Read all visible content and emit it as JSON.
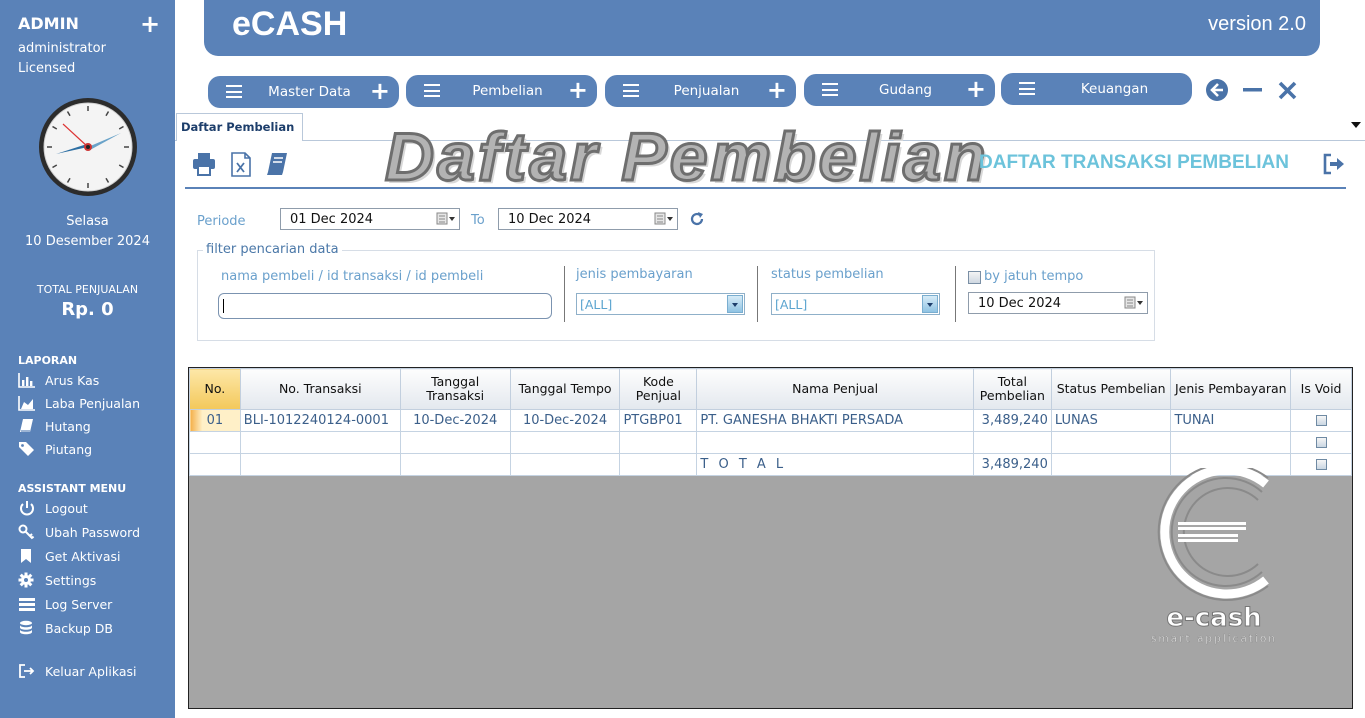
{
  "sidebar": {
    "user": "ADMIN",
    "role_line1": "administrator",
    "role_line2": "Licensed",
    "day": "Selasa",
    "date": "10 Desember 2024",
    "total_label": "TOTAL PENJUALAN",
    "total_value": "Rp. 0",
    "laporan_heading": "LAPORAN",
    "laporan": [
      "Arus Kas",
      "Laba Penjualan",
      "Hutang",
      "Piutang"
    ],
    "assistant_heading": "ASSISTANT MENU",
    "assistant": [
      "Logout",
      "Ubah Password",
      "Get Aktivasi",
      "Settings",
      "Log Server",
      "Backup DB"
    ],
    "exit_label": "Keluar Aplikasi"
  },
  "header": {
    "app_name": "eCASH",
    "version": "version 2.0"
  },
  "menu": [
    "Master Data",
    "Pembelian",
    "Penjualan",
    "Gudang",
    "Keuangan"
  ],
  "tab": {
    "label": "Daftar Pembelian"
  },
  "page": {
    "banner_title": "Daftar Pembelian",
    "heading": "DAFTAR TRANSAKSI PEMBELIAN"
  },
  "filters": {
    "periode_label": "Periode",
    "from_date": "01 Dec 2024",
    "to_label": "To",
    "to_date": "10 Dec 2024",
    "fieldset_legend": "filter pencarian data",
    "search_label": "nama pembeli / id transaksi / id pembeli",
    "search_value": "",
    "jenis_label": "jenis pembayaran",
    "jenis_value": "[ALL]",
    "status_label": "status pembelian",
    "status_value": "[ALL]",
    "jatuh_tempo_label": "by jatuh tempo",
    "jatuh_tempo_date": "10 Dec 2024"
  },
  "grid": {
    "headers": [
      "No.",
      "No. Transaksi",
      "Tanggal Transaksi",
      "Tanggal Tempo",
      "Kode Penjual",
      "Nama Penjual",
      "Total Pembelian",
      "Status Pembelian",
      "Jenis Pembayaran",
      "Is Void"
    ],
    "rows": [
      [
        "01",
        "BLI-1012240124-0001",
        "10-Dec-2024",
        "10-Dec-2024",
        "PTGBP01",
        "PT. GANESHA BHAKTI PERSADA",
        "3,489,240",
        "LUNAS",
        "TUNAI"
      ],
      [
        "",
        "",
        "",
        "",
        "",
        "",
        "",
        "",
        ""
      ]
    ],
    "total_label": "T O T A L",
    "total_value": "3,489,240"
  },
  "logo": {
    "text": "e-cash",
    "tagline": "smart application"
  },
  "colors": {
    "sidebar": "#5a82b8",
    "accent_heading": "#6cc3db",
    "grid_empty": "#a5a5a5"
  },
  "icons": {
    "toolbar": [
      "print-icon",
      "excel-icon",
      "book-icon"
    ],
    "window": [
      "back-icon",
      "minimize-icon",
      "close-icon"
    ]
  }
}
